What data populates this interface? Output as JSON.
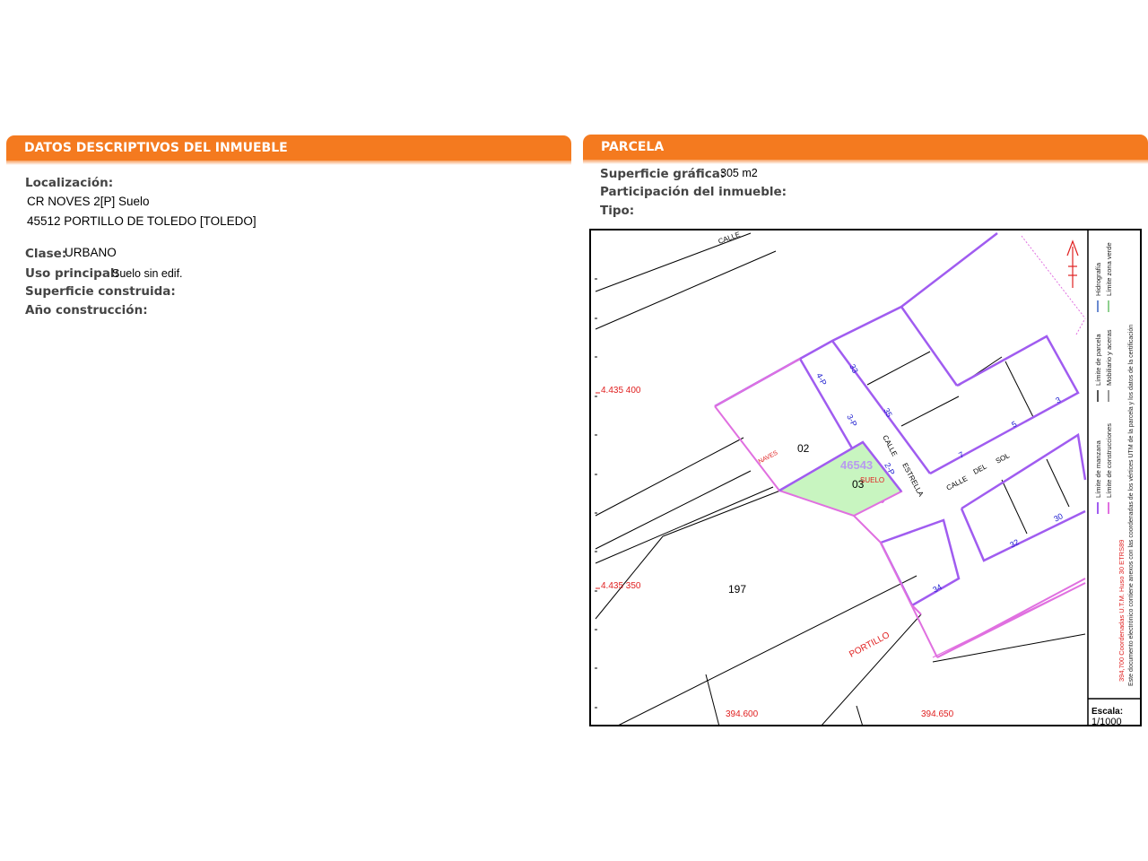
{
  "left_panel": {
    "title": "DATOS DESCRIPTIVOS DEL INMUEBLE",
    "localizacion_label": "Localización:",
    "address_line1": "CR NOVES 2[P] Suelo",
    "address_line2": "45512 PORTILLO DE TOLEDO [TOLEDO]",
    "clase_label": "Clase:",
    "clase_value": "URBANO",
    "uso_label": "Uso principal:",
    "uso_value": "Suelo sin edif.",
    "superficie_construida_label": "Superficie construida:",
    "anio_label": "Año construcción:"
  },
  "right_panel": {
    "title": "PARCELA",
    "superficie_grafica_label": "Superficie gráfica:",
    "superficie_grafica_value": "305 m2",
    "participacion_label": "Participación del inmueble:",
    "tipo_label": "Tipo:"
  },
  "map": {
    "y_coord_top": "4.435 400",
    "y_coord_bottom": "4.435 350",
    "x_coord_left": "394.600",
    "x_coord_right": "394.650",
    "block_id": "46543",
    "parcel_02": "02",
    "parcel_03": "03",
    "parcel_197": "197",
    "suelo_label": "SUELO",
    "naves_label": "NAVES",
    "street_calle_top": "CALLE",
    "street_calle": "CALLE",
    "street_estrella": "ESTRELLA",
    "street_calle_sol": "CALLE",
    "street_del": "DEL",
    "street_sol": "SOL",
    "street_portillo": "PORTILLO",
    "house_33": "33",
    "house_35": "35",
    "house_4p": "4-P",
    "house_3p": "3-P",
    "house_2p": "2-P",
    "house_3": "3",
    "house_5": "5",
    "house_7": "7",
    "house_30": "30",
    "house_32": "32",
    "house_34": "34",
    "legend_limite_manzana": "Límite de manzana",
    "legend_limite_parcela": "Límite de parcela",
    "legend_hidrografia": "Hidrografía",
    "legend_limite_construcciones": "Límite de construcciones",
    "legend_mobiliario": "Mobiliario y aceras",
    "legend_zona_verde": "Límite zona verde",
    "utm_note": "394,700 Coordenadas U.T.M. Huso 30 ETRS89",
    "cert_note": "Este documento electrónico contiene anexos con las coordenadas de los vértices UTM de la parcela y los datos de la certificación",
    "escala_label": "Escala:",
    "escala_value": "1/1000",
    "colors": {
      "manzana": "#a05cf0",
      "parcela_pink": "#e070e0",
      "parcel_fill": "#c8f5c0",
      "coord_red": "#e02020",
      "house_blue": "#2020d0"
    }
  }
}
